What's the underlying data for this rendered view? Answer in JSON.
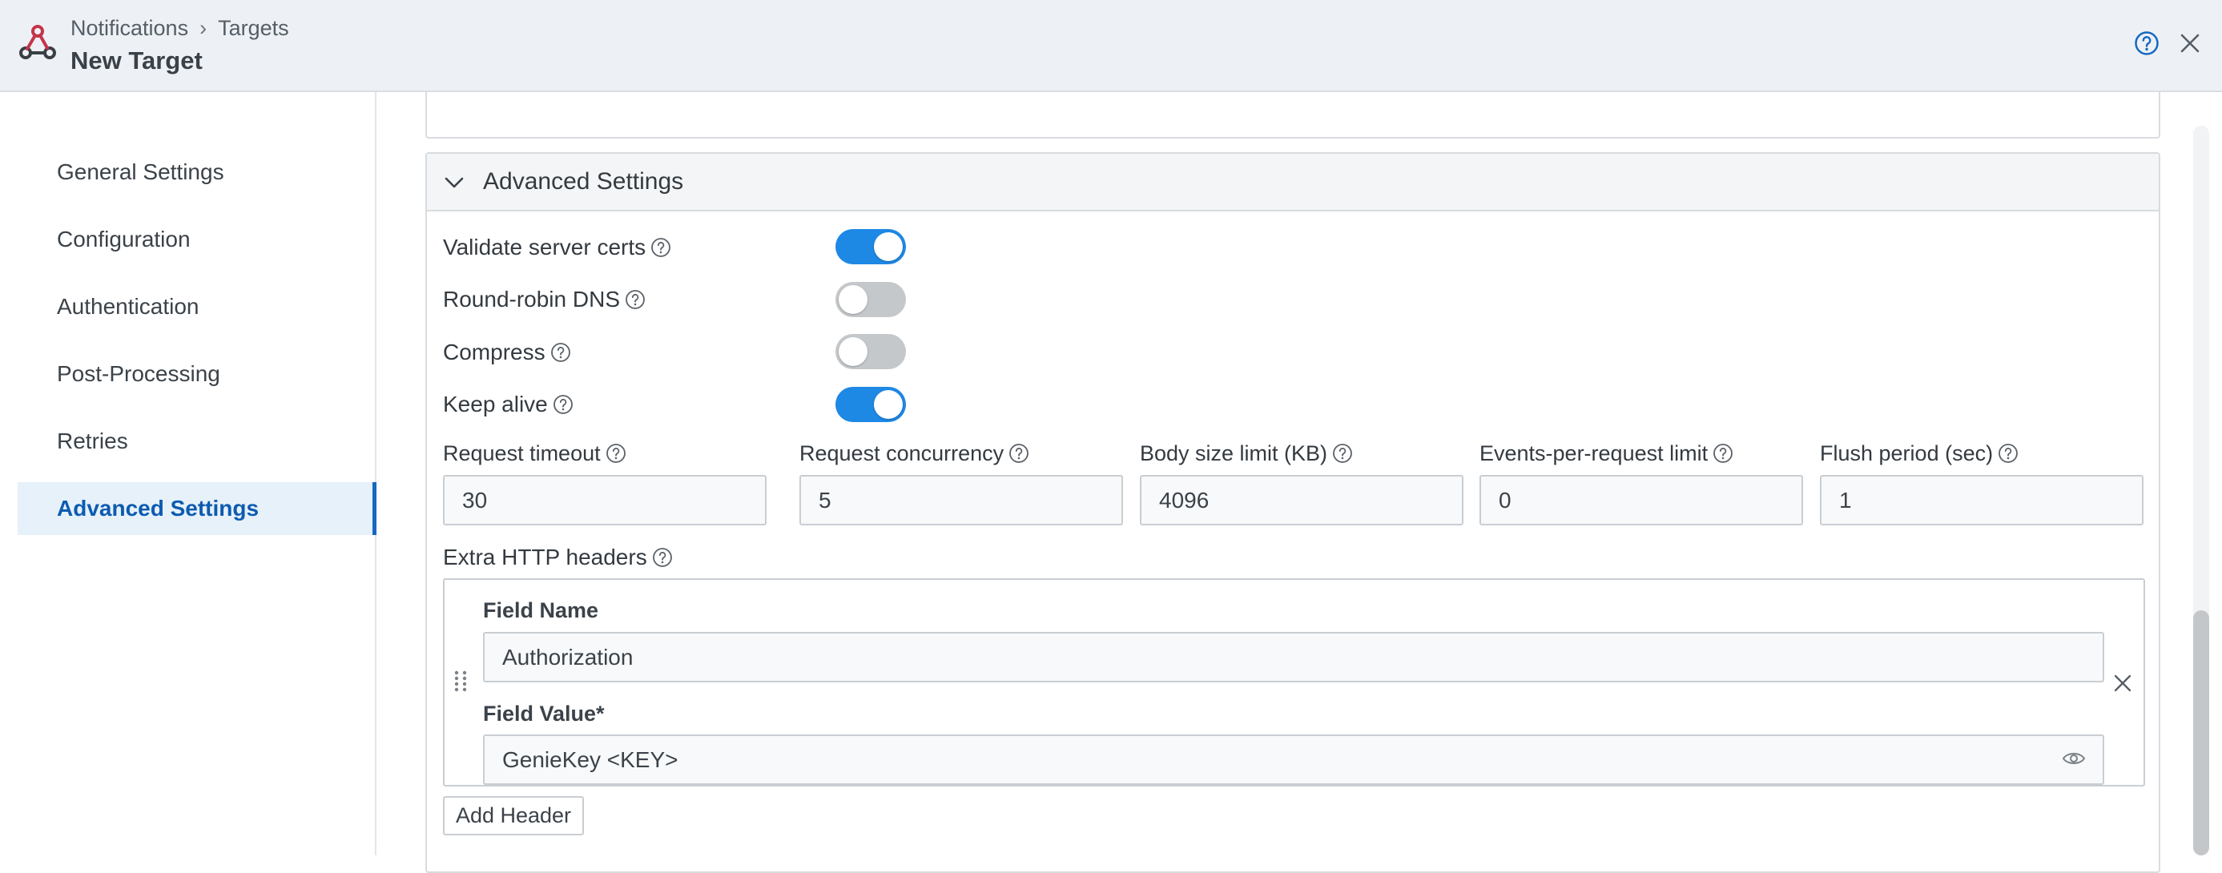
{
  "header": {
    "breadcrumb": [
      "Notifications",
      "Targets"
    ],
    "breadcrumb_separator": "›",
    "title": "New Target",
    "logo_icon": "webhook-icon",
    "actions": {
      "help_icon": "question-circle-icon",
      "close_icon": "close-icon"
    }
  },
  "sidebar": {
    "items": [
      {
        "label": "General Settings",
        "active": false
      },
      {
        "label": "Configuration",
        "active": false
      },
      {
        "label": "Authentication",
        "active": false
      },
      {
        "label": "Post-Processing",
        "active": false
      },
      {
        "label": "Retries",
        "active": false
      },
      {
        "label": "Advanced Settings",
        "active": true
      }
    ]
  },
  "advanced": {
    "section_title": "Advanced Settings",
    "expanded": true,
    "toggles": [
      {
        "label": "Validate server certs",
        "on": true
      },
      {
        "label": "Round-robin DNS",
        "on": false
      },
      {
        "label": "Compress",
        "on": false
      },
      {
        "label": "Keep alive",
        "on": true
      }
    ],
    "fields": [
      {
        "label": "Request timeout",
        "value": "30"
      },
      {
        "label": "Request concurrency",
        "value": "5"
      },
      {
        "label": "Body size limit (KB)",
        "value": "4096"
      },
      {
        "label": "Events-per-request limit",
        "value": "0"
      },
      {
        "label": "Flush period (sec)",
        "value": "1"
      }
    ],
    "extra_headers": {
      "label": "Extra HTTP headers",
      "field_name_label": "Field Name",
      "field_name_value": "Authorization",
      "field_value_label": "Field Value*",
      "field_value_value": "GenieKey <KEY>",
      "add_button": "Add Header"
    }
  },
  "colors": {
    "accent": "#1e88e5",
    "nav_active_text": "#0d5bb0",
    "nav_active_bg": "#e6f1fa",
    "header_bg": "#edf1f5",
    "logo_red": "#c4344a"
  }
}
